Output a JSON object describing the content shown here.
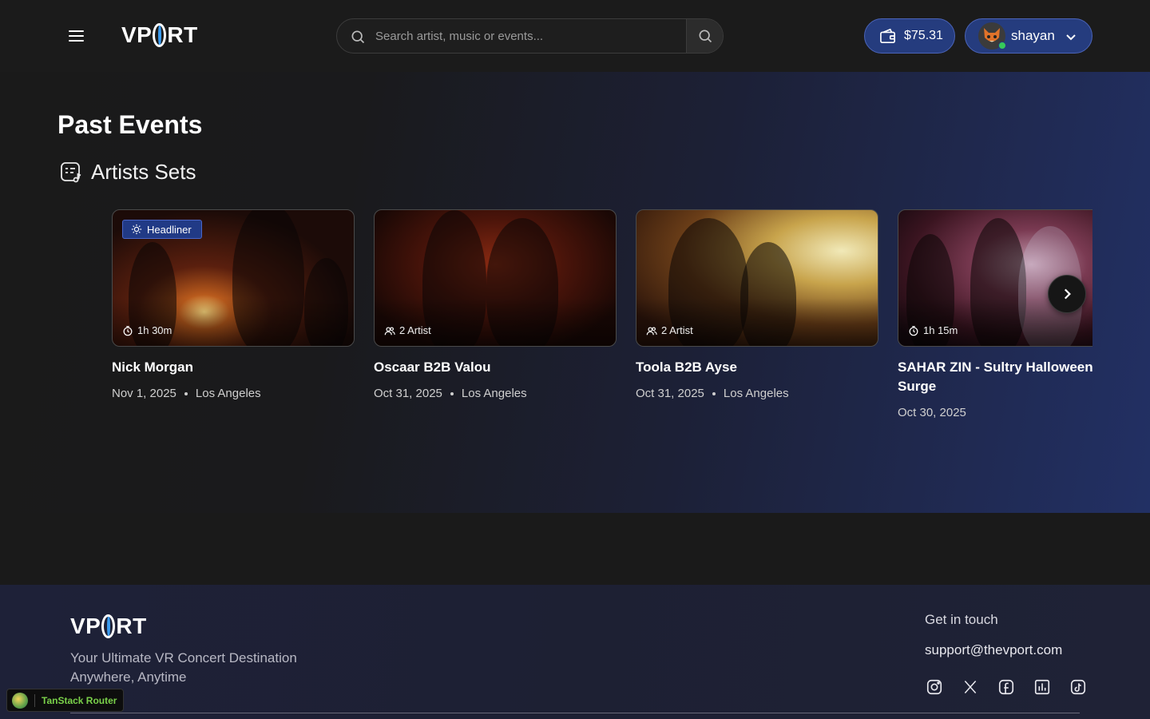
{
  "header": {
    "logo_left": "VP",
    "logo_right": "RT",
    "search_placeholder": "Search artist, music or events...",
    "wallet_balance": "$75.31",
    "username": "shayan",
    "avatar_icon": "fox-avatar"
  },
  "page": {
    "title": "Past Events",
    "section_title": "Artists Sets"
  },
  "cards": [
    {
      "badge": "Headliner",
      "chip": "1h 30m",
      "chip_icon": "timer-icon",
      "title": "Nick Morgan",
      "date": "Nov 1, 2025",
      "location": "Los Angeles"
    },
    {
      "badge": "",
      "chip": "2 Artist",
      "chip_icon": "users-icon",
      "title": "Oscaar B2B Valou",
      "date": "Oct 31, 2025",
      "location": "Los Angeles"
    },
    {
      "badge": "",
      "chip": "2 Artist",
      "chip_icon": "users-icon",
      "title": "Toola B2B Ayse",
      "date": "Oct 31, 2025",
      "location": "Los Angeles"
    },
    {
      "badge": "",
      "chip": "1h 15m",
      "chip_icon": "timer-icon",
      "title": "SAHAR ZIN - Sultry Halloween - Soul Surge",
      "date": "Oct 30, 2025",
      "location": ""
    }
  ],
  "footer": {
    "logo_left": "VP",
    "logo_right": "RT",
    "tagline_line1": "Your Ultimate VR Concert Destination",
    "tagline_line2": "Anywhere, Anytime",
    "contact_title": "Get in touch",
    "contact_email": "support@thevport.com",
    "socials": [
      "instagram-icon",
      "x-icon",
      "facebook-icon",
      "charts-icon",
      "tiktok-icon"
    ]
  },
  "devtools": {
    "label": "TanStack Router"
  },
  "colors": {
    "accent": "#253c7e",
    "accent_border": "#4b64b8",
    "logo_o": "#3b9cf0",
    "online": "#36c95a"
  }
}
